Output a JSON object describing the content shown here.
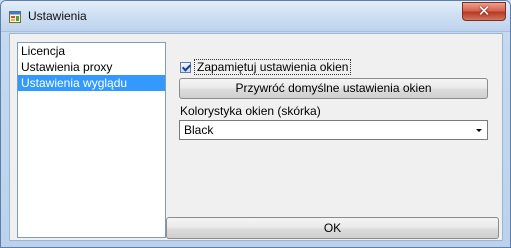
{
  "window": {
    "title": "Ustawienia",
    "close_glyph": "✕"
  },
  "sidebar": {
    "items": [
      {
        "label": "Licencja",
        "selected": false
      },
      {
        "label": "Ustawienia proxy",
        "selected": false
      },
      {
        "label": "Ustawienia wyglądu",
        "selected": true
      }
    ]
  },
  "appearance": {
    "remember_windows": {
      "label": "Zapamiętuj ustawienia okien",
      "checked": true
    },
    "restore_button_label": "Przywróć domyślne ustawienia okien",
    "skin_label": "Kolorystyka okien (skórka)",
    "skin_value": "Black"
  },
  "footer": {
    "ok_label": "OK"
  },
  "colors": {
    "selection": "#3399ff",
    "close_button": "#c8503a",
    "titlebar": "#cfe0f4"
  },
  "icons": {
    "app_icon": "settings-window-icon",
    "close_icon": "close-icon",
    "checkbox_icon": "checkmark-icon",
    "dropdown_icon": "chevron-down-icon"
  }
}
